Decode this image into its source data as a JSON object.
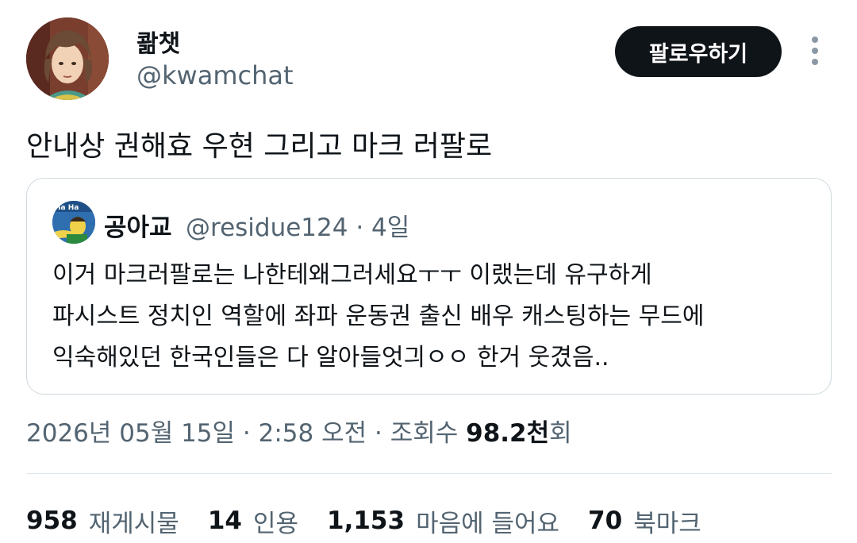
{
  "author": {
    "display_name": "콺챗",
    "handle": "@kwamchat",
    "follow_label": "팔로우하기"
  },
  "tweet": {
    "text": "안내상 권해효 우현 그리고 마크 러팔로",
    "date": "2026년 05월 15일",
    "separator": " · ",
    "time": "2:58 오전",
    "views_label": "조회수 ",
    "views_count": "98.2천",
    "views_suffix": "회"
  },
  "quote": {
    "display_name": "공아교",
    "handle": "@residue124",
    "age": " · 4일",
    "avatar_text": "Ha Ha",
    "lines": [
      "이거 마크러팔로는 나한테왜그러세요ㅜㅜ 이랬는데 유구하게",
      "파시스트 정치인 역할에 좌파 운동권 출신 배우 캐스팅하는 무드에",
      "익숙해있던 한국인들은 다 알아들엇긔ㅇㅇ 한거 웃겼음.."
    ]
  },
  "stats": [
    {
      "count": "958",
      "label": "재게시물"
    },
    {
      "count": "14",
      "label": "인용"
    },
    {
      "count": "1,153",
      "label": "마음에 들어요"
    },
    {
      "count": "70",
      "label": "북마크"
    }
  ],
  "colors": {
    "text": "#0f1419",
    "secondary": "#536471",
    "button_bg": "#0f1419",
    "border": "#cfd9de"
  }
}
